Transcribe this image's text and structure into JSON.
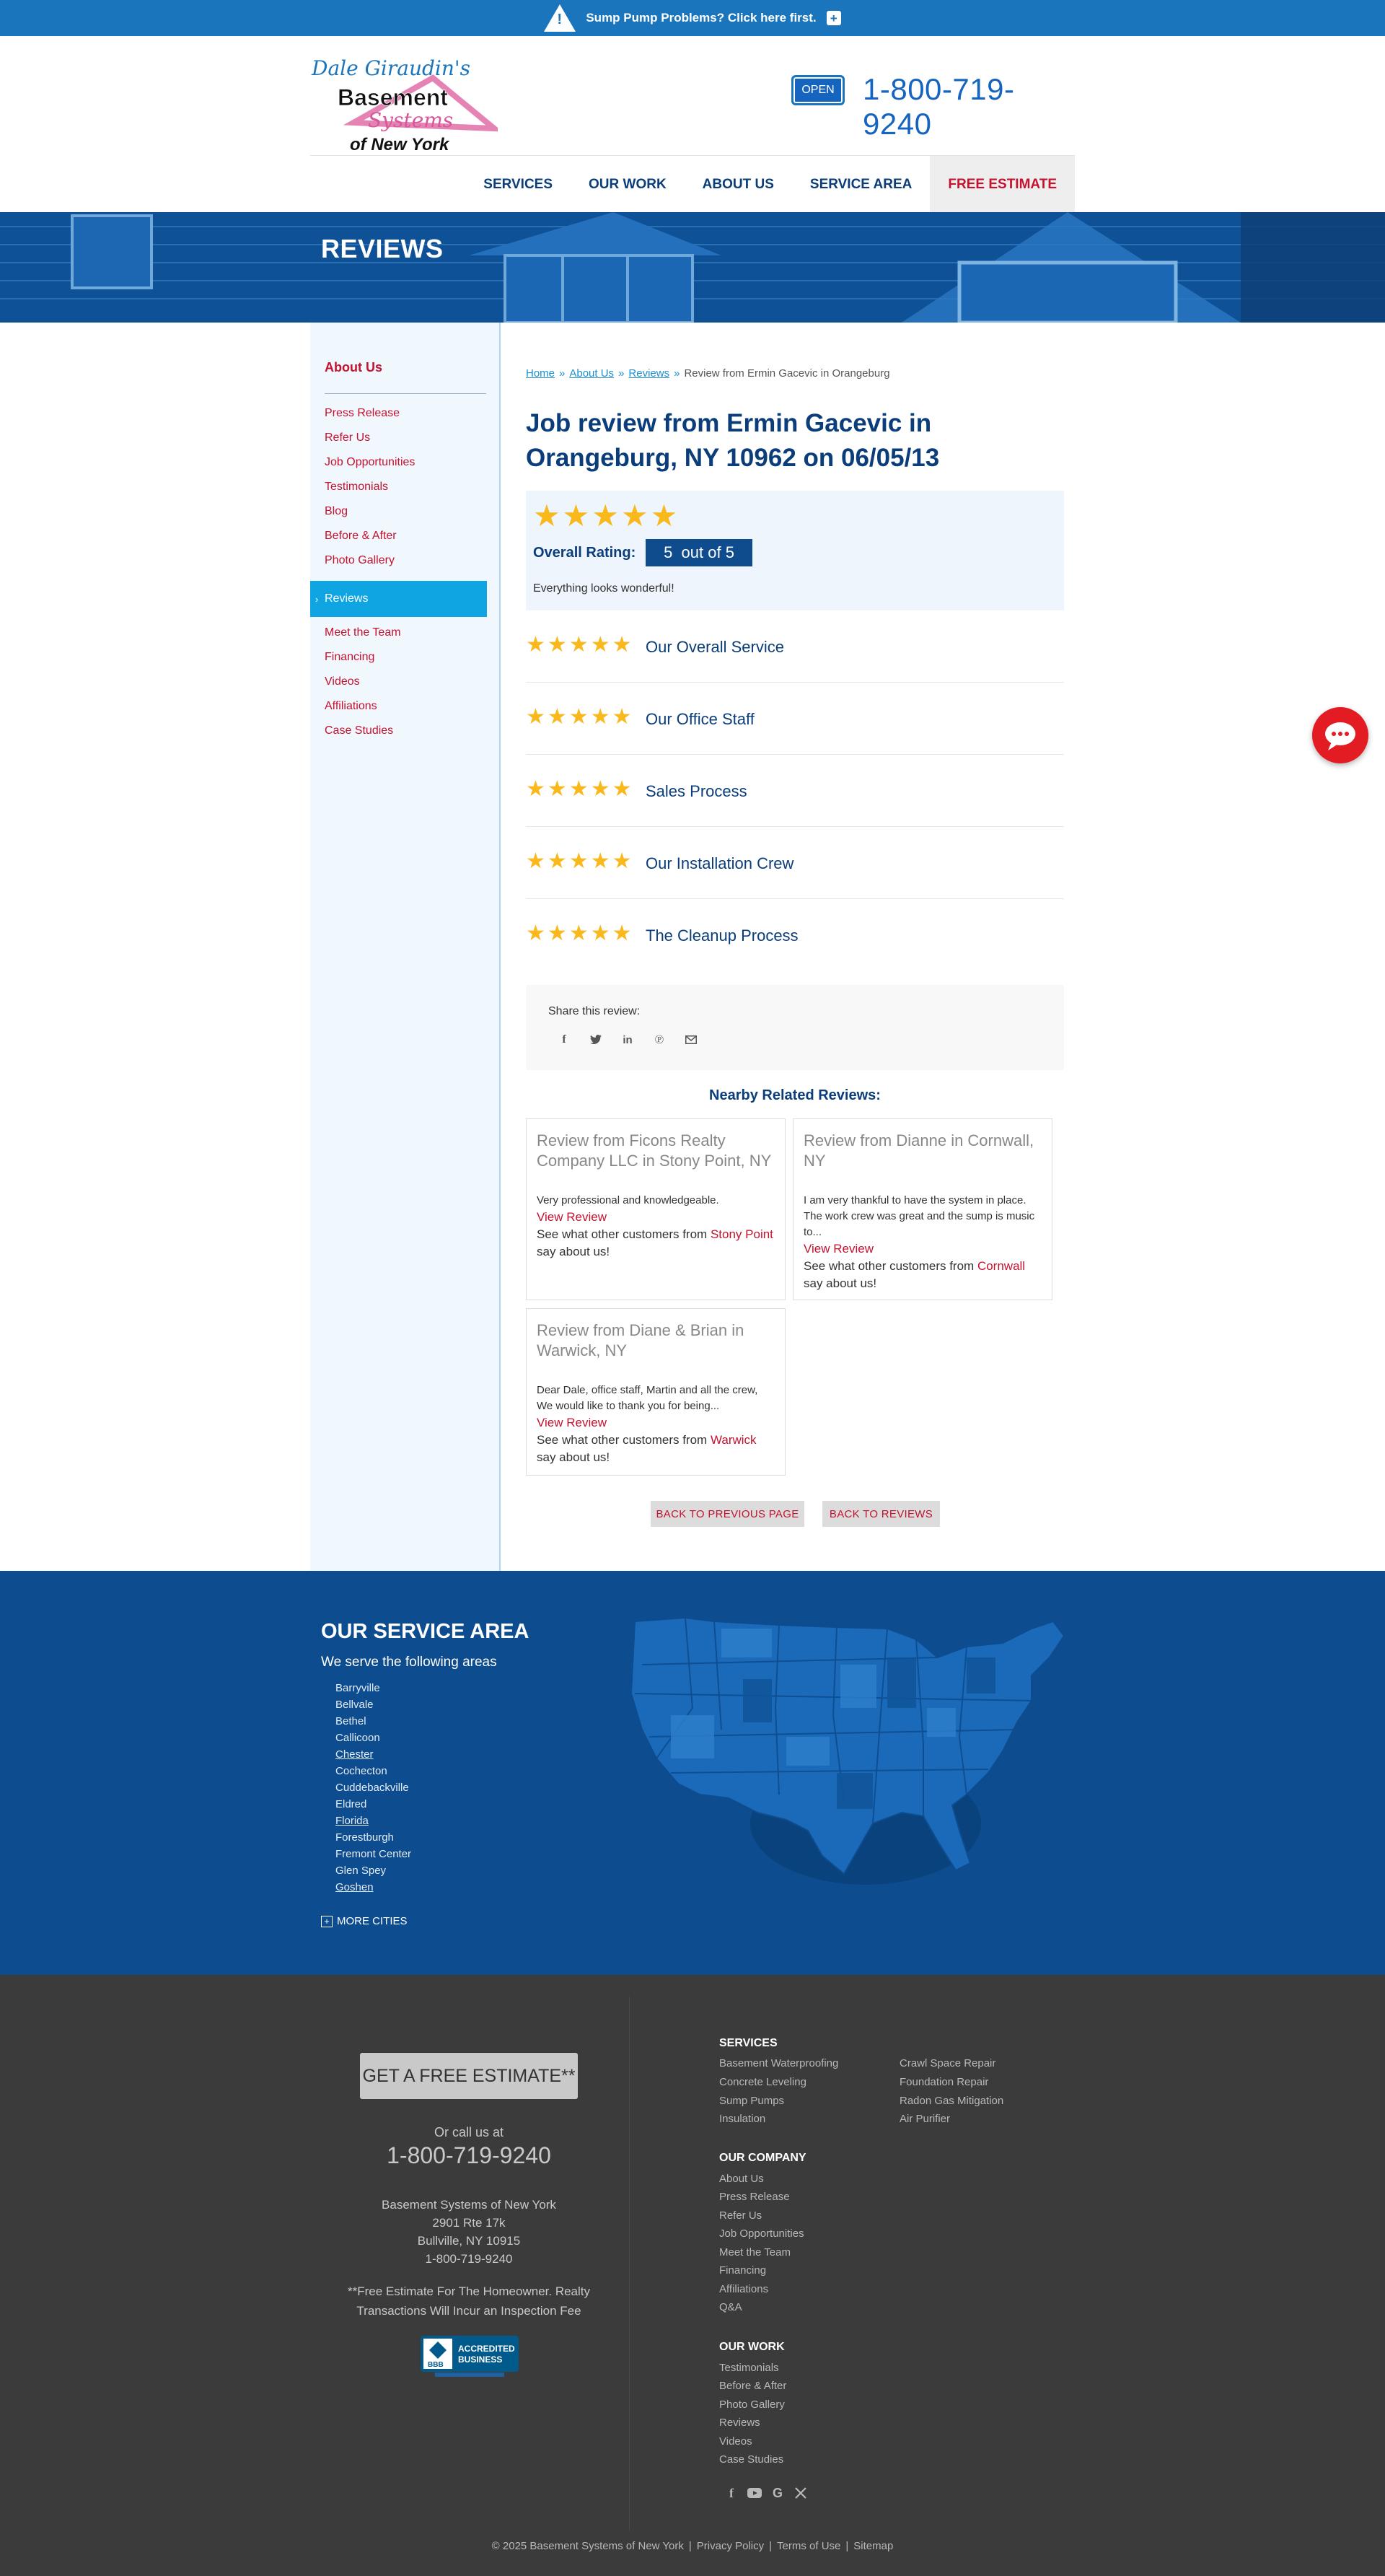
{
  "banner": {
    "text": "Sump Pump Problems? Click here first."
  },
  "header": {
    "logo": {
      "line1": "Dale Giraudin's",
      "line2": "Basement",
      "line3": "Systems",
      "line4": "of New York"
    },
    "open_badge": "OPEN",
    "phone": "1-800-719-9240"
  },
  "nav": {
    "items": [
      "SERVICES",
      "OUR WORK",
      "ABOUT US",
      "SERVICE AREA"
    ],
    "estimate": "FREE ESTIMATE"
  },
  "hero": {
    "title": "REVIEWS"
  },
  "sidebar": {
    "title": "About Us",
    "items": [
      "Press Release",
      "Refer Us",
      "Job Opportunities",
      "Testimonials",
      "Blog",
      "Before & After",
      "Photo Gallery"
    ],
    "active": "Reviews",
    "items_after": [
      "Meet the Team",
      "Financing",
      "Videos",
      "Affiliations",
      "Case Studies"
    ]
  },
  "breadcrumb": {
    "home": "Home",
    "about": "About Us",
    "reviews": "Reviews",
    "current": "Review from Ermin Gacevic in Orangeburg",
    "sep": "»"
  },
  "review": {
    "title": "Job review from Ermin Gacevic in Orangeburg, NY 10962 on 06/05/13",
    "overall_label": "Overall Rating:",
    "overall_value": "5",
    "overall_suffix": "out of 5",
    "stars": 5,
    "comment": "Everything looks wonderful!",
    "categories": [
      {
        "label": "Our Overall Service",
        "stars": 5
      },
      {
        "label": "Our Office Staff",
        "stars": 5
      },
      {
        "label": "Sales Process",
        "stars": 5
      },
      {
        "label": "Our Installation Crew",
        "stars": 5
      },
      {
        "label": "The Cleanup Process",
        "stars": 5
      }
    ]
  },
  "share": {
    "label": "Share this review:",
    "icons": [
      "facebook-icon",
      "twitter-icon",
      "linkedin-icon",
      "pinterest-icon",
      "email-icon"
    ]
  },
  "nearby": {
    "title": "Nearby Related Reviews:",
    "view_label": "View Review",
    "more_prefix": "See what other customers from",
    "more_suffix": "say about us!",
    "cards": [
      {
        "title": "Review from Ficons Realty Company LLC in Stony Point, NY",
        "body": "Very professional and knowledgeable.",
        "city": "Stony Point"
      },
      {
        "title": "Review from Dianne in Cornwall, NY",
        "body": "I am very thankful to have the system in place. The work crew was great and the sump is music to...",
        "city": "Cornwall"
      },
      {
        "title": "Review from Diane & Brian in Warwick, NY",
        "body": "Dear Dale, office staff, Martin and all the crew, We would like to thank you for being...",
        "city": "Warwick"
      }
    ]
  },
  "buttons": {
    "back_previous": "BACK TO PREVIOUS PAGE",
    "back_reviews": "BACK TO REVIEWS"
  },
  "service_area": {
    "title": "OUR SERVICE AREA",
    "subtitle": "We serve the following areas",
    "cities": [
      "Barryville",
      "Bellvale",
      "Bethel",
      "Callicoon",
      "Chester",
      "Cochecton",
      "Cuddebackville",
      "Eldred",
      "Florida",
      "Forestburgh",
      "Fremont Center",
      "Glen Spey",
      "Goshen"
    ],
    "linked_cities": [
      "Chester",
      "Florida",
      "Goshen"
    ],
    "more": "MORE CITIES"
  },
  "footer": {
    "estimate_button": "GET A FREE ESTIMATE**",
    "call_label": "Or call us at",
    "phone": "1-800-719-9240",
    "address": [
      "Basement Systems of New York",
      "2901 Rte 17k",
      "Bullville, NY 10915",
      "1-800-719-9240"
    ],
    "note": [
      "**Free Estimate For The Homeowner. Realty",
      "Transactions Will Incur an Inspection Fee"
    ],
    "bbb": {
      "line1": "ACCREDITED",
      "line2": "BUSINESS",
      "mark": "BBB"
    },
    "services_title": "SERVICES",
    "services_left": [
      "Basement Waterproofing",
      "Concrete Leveling",
      "Sump Pumps",
      "Insulation"
    ],
    "services_right": [
      "Crawl Space Repair",
      "Foundation Repair",
      "Radon Gas Mitigation",
      "Air Purifier"
    ],
    "company_title": "OUR COMPANY",
    "company": [
      "About Us",
      "Press Release",
      "Refer Us",
      "Job Opportunities",
      "Meet the Team",
      "Financing",
      "Affiliations",
      "Q&A"
    ],
    "work_title": "OUR WORK",
    "work": [
      "Testimonials",
      "Before & After",
      "Photo Gallery",
      "Reviews",
      "Videos",
      "Case Studies"
    ],
    "copyright": "© 2025 Basement Systems of New York",
    "legal": [
      "Privacy Policy",
      "Terms of Use",
      "Sitemap"
    ]
  },
  "colors": {
    "brand_blue": "#1b75bc",
    "navy": "#0a3d7a",
    "accent_red": "#c4122f",
    "star": "#f9b81b",
    "footer_bg": "#3b3b3b",
    "service_bg": "#0d4c8f"
  }
}
